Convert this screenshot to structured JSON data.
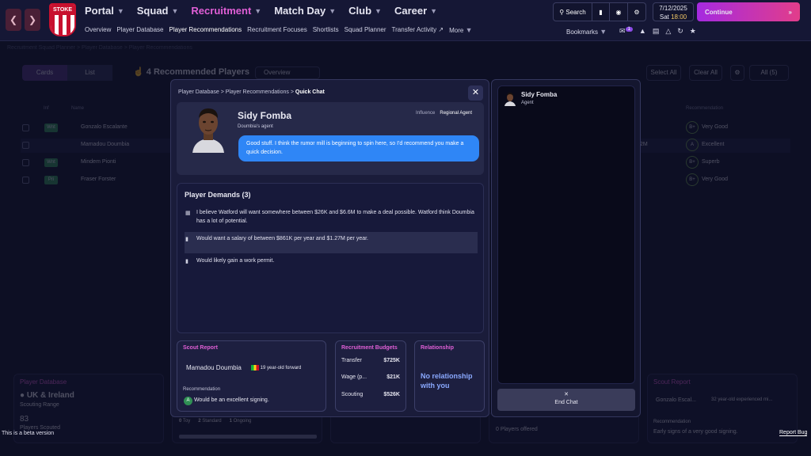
{
  "topbar": {
    "nav": [
      {
        "label": "Portal",
        "active": false
      },
      {
        "label": "Squad",
        "active": false
      },
      {
        "label": "Recruitment",
        "active": true
      },
      {
        "label": "Match Day",
        "active": false
      },
      {
        "label": "Club",
        "active": false
      },
      {
        "label": "Career",
        "active": false
      }
    ],
    "subnav": [
      "Overview",
      "Player Database",
      "Player Recommendations",
      "Recruitment Focuses",
      "Shortlists",
      "Squad Planner",
      "Transfer Activity",
      "More"
    ],
    "search_label": "Search",
    "date": "7/12/2025",
    "day": "Sat",
    "time": "18:00",
    "continue_label": "Continue",
    "bookmarks_label": "Bookmarks",
    "notification_count": "1",
    "crest_text": "STOKE"
  },
  "background": {
    "breadcrumb": "Recruitment  Squad Planner  >  Player Database  >  Player Recommendations",
    "view_cards": "Cards",
    "view_list": "List",
    "page_title": "4 Recommended Players",
    "overview_select": "Overview",
    "select_all": "Select All",
    "clear_all": "Clear All",
    "all_count": "All (5)",
    "col_inf": "Inf",
    "col_name": "Name",
    "col_recommendation": "Recommendation",
    "rows": [
      {
        "tag": "Wnt",
        "name": "Gonzalo Escalante",
        "rec": "B+",
        "rec_label": "Very Good"
      },
      {
        "tag": "",
        "name": "Mamadou Doumbia",
        "rec": "A",
        "rec_label": "Excellent"
      },
      {
        "tag": "Wnt",
        "name": "Mindem Pionti",
        "rec": "B+",
        "rec_label": "Superb"
      },
      {
        "tag": "Pri",
        "name": "Fraser Forster",
        "rec": "B+",
        "rec_label": "Very Good"
      }
    ],
    "row2_value": "2M",
    "db_card_title": "Player Database",
    "db_region": "UK & Ireland",
    "db_scouting_range": "Scouting Range",
    "db_count": "83",
    "db_scouted": "Players Scouted",
    "db_status": [
      "Toy",
      "Standard",
      "Ongoing"
    ],
    "db_status_counts": [
      "0",
      "2",
      "1"
    ],
    "offered": "0 Players offered",
    "sr_card_title": "Scout Report",
    "sr_player": "Gonzalo Escal...",
    "sr_desc": "32 year-old experienced mi...",
    "sr_rec_label": "Recommendation",
    "sr_rec_text": "Early signs of a very good signing."
  },
  "modal": {
    "breadcrumb": [
      "Player Database",
      "Player Recommendations",
      "Quick Chat"
    ],
    "agent_name": "Sidy Fomba",
    "agent_role": "Doumbia's agent",
    "influence_label": "Influence",
    "influence_value": "Regional Agent",
    "message": "Good stuff. I think the rumor mill is beginning to spin here, so I'd recommend you make a quick decision.",
    "demands_title": "Player Demands (3)",
    "demand1": "I believe Watford will want somewhere between $26K and $6.6M to make a deal possible. Watford think Doumbia has a lot of potential.",
    "demand2": "Would want a salary of between $861K per year and $1.27M per year.",
    "demand3": "Would likely gain a work permit.",
    "scout_title": "Scout Report",
    "scout_player": "Mamadou Doumbia",
    "scout_desc": "19 year-old forward",
    "scout_rec_label": "Recommendation",
    "scout_rec_grade": "A",
    "scout_rec_text": "Would be an excellent signing.",
    "budgets_title": "Recruitment Budgets",
    "budget_transfer_label": "Transfer",
    "budget_transfer_value": "$725K",
    "budget_wage_label": "Wage (p...",
    "budget_wage_value": "$21K",
    "budget_scouting_label": "Scouting",
    "budget_scouting_value": "$526K",
    "relationship_title": "Relationship",
    "relationship_text": "No relationship with you"
  },
  "chat": {
    "name": "Sidy Fomba",
    "role": "Agent",
    "end_chat": "End Chat"
  },
  "footer": {
    "beta": "This is a beta version",
    "report_bug": "Report Bug"
  },
  "colors": {
    "accent_pink": "#e05fd6",
    "bubble_blue": "#2f86f6",
    "continue_gradient": "#a52ae0",
    "grade_green": "#2f8f54"
  }
}
